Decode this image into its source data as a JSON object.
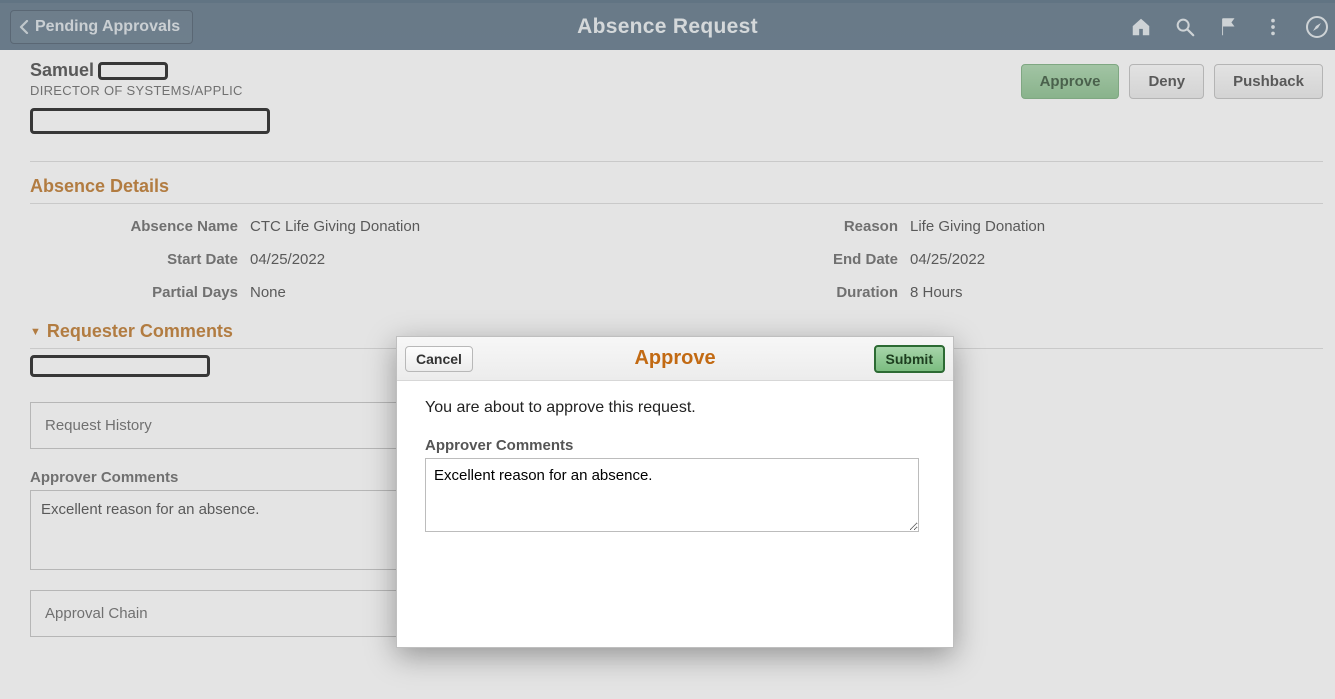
{
  "topbar": {
    "back_label": "Pending Approvals",
    "title": "Absence Request"
  },
  "person": {
    "first_name": "Samuel",
    "role": "DIRECTOR OF SYSTEMS/APPLIC"
  },
  "actions": {
    "approve": "Approve",
    "deny": "Deny",
    "pushback": "Pushback"
  },
  "sections": {
    "absence_details": "Absence Details",
    "requester_comments": "Requester Comments",
    "approver_comments_label": "Approver Comments"
  },
  "details": {
    "absence_name_label": "Absence Name",
    "absence_name_value": "CTC Life Giving Donation",
    "reason_label": "Reason",
    "reason_value": "Life Giving Donation",
    "start_date_label": "Start Date",
    "start_date_value": "04/25/2022",
    "end_date_label": "End Date",
    "end_date_value": "04/25/2022",
    "partial_days_label": "Partial Days",
    "partial_days_value": "None",
    "duration_label": "Duration",
    "duration_value": "8 Hours"
  },
  "rows": {
    "request_history": "Request History",
    "approval_chain": "Approval Chain"
  },
  "comments": {
    "approver_value": "Excellent reason for an absence."
  },
  "modal": {
    "title": "Approve",
    "cancel": "Cancel",
    "submit": "Submit",
    "message": "You are about to approve this request.",
    "label": "Approver Comments",
    "value": "Excellent reason for an absence."
  }
}
